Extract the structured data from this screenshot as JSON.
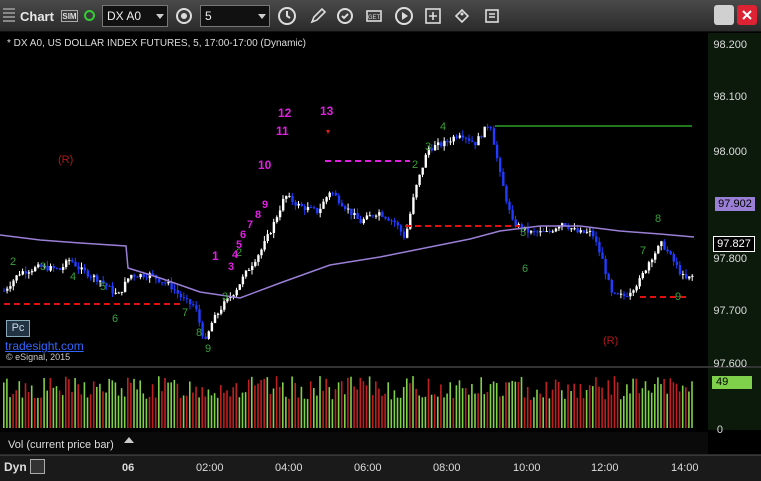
{
  "toolbar": {
    "title": "Chart",
    "sim_badge": "SIM",
    "symbol": "DX A0",
    "interval": "5",
    "icons": [
      "link-icon",
      "pencil-icon",
      "refresh-icon",
      "study-icon",
      "play-icon",
      "tag-icon",
      "note-icon"
    ],
    "window_buttons": [
      "restore-icon",
      "close-icon"
    ]
  },
  "chart": {
    "header": "* DX A0, US DOLLAR INDEX FUTURES, 5, 17:00-17:00 (Dynamic)",
    "watermark_link": "tradesight.com",
    "copyright": "© eSignal, 2015",
    "pc_badge": "Pc",
    "volume_label": "Vol (current price bar)",
    "footer_tab": "Dyn",
    "price_axis": [
      "98.200",
      "98.100",
      "98.000",
      "97.900",
      "97.800",
      "97.700",
      "97.600"
    ],
    "time_axis": [
      "06",
      "02:00",
      "04:00",
      "06:00",
      "08:00",
      "10:00",
      "12:00",
      "14:00"
    ],
    "last_price": "97.827",
    "ma_price": "97.902",
    "volume_last": "49",
    "volume_axis_zero": "0",
    "annotations": {
      "r_left": "(R)",
      "r_right": "(R)",
      "n1": "1",
      "n10": "10",
      "n11": "11",
      "n12": "12",
      "n13": "13",
      "seq": [
        "2",
        "3",
        "4",
        "5",
        "6",
        "7",
        "8",
        "9"
      ]
    },
    "colors": {
      "up_bar": "#ffffff",
      "down_bar": "#1f3cff",
      "ma_line": "#9a7fd6",
      "support_line": "#e01010",
      "resistance_line": "#2aa02a",
      "magenta": "#e020e0",
      "axis_bg": "#0c1a0c",
      "volume_up": "#7fd04a",
      "volume_down": "#c02020"
    }
  }
}
